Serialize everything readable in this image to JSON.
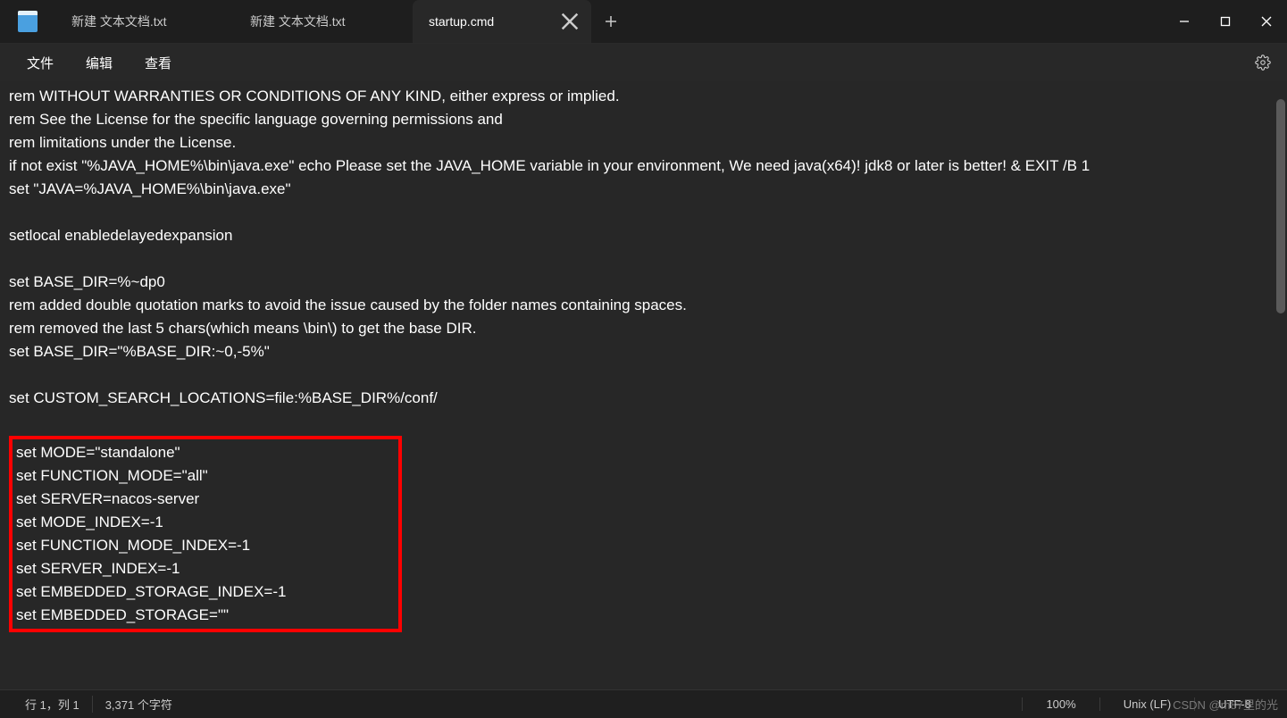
{
  "tabs": [
    {
      "label": "新建 文本文档.txt",
      "active": false
    },
    {
      "label": "新建 文本文档.txt",
      "active": false
    },
    {
      "label": "startup.cmd",
      "active": true
    }
  ],
  "menu": {
    "file": "文件",
    "edit": "编辑",
    "view": "查看"
  },
  "content": {
    "lines_pre": [
      "rem WITHOUT WARRANTIES OR CONDITIONS OF ANY KIND, either express or implied.",
      "rem See the License for the specific language governing permissions and",
      "rem limitations under the License.",
      "if not exist \"%JAVA_HOME%\\bin\\java.exe\" echo Please set the JAVA_HOME variable in your environment, We need java(x64)! jdk8 or later is better! & EXIT /B 1",
      "set \"JAVA=%JAVA_HOME%\\bin\\java.exe\"",
      "",
      "setlocal enabledelayedexpansion",
      "",
      "set BASE_DIR=%~dp0",
      "rem added double quotation marks to avoid the issue caused by the folder names containing spaces.",
      "rem removed the last 5 chars(which means \\bin\\) to get the base DIR.",
      "set BASE_DIR=\"%BASE_DIR:~0,-5%\"",
      "",
      "set CUSTOM_SEARCH_LOCATIONS=file:%BASE_DIR%/conf/",
      ""
    ],
    "lines_highlight": [
      "set MODE=\"standalone\"",
      "set FUNCTION_MODE=\"all\"",
      "set SERVER=nacos-server",
      "set MODE_INDEX=-1",
      "set FUNCTION_MODE_INDEX=-1",
      "set SERVER_INDEX=-1",
      "set EMBEDDED_STORAGE_INDEX=-1",
      "set EMBEDDED_STORAGE=\"\""
    ]
  },
  "status": {
    "position": "行 1，列 1",
    "chars": "3,371 个字符",
    "zoom": "100%",
    "line_ending": "Unix (LF)",
    "encoding": "UTF-8"
  },
  "watermark": "CSDN @m87里的光"
}
